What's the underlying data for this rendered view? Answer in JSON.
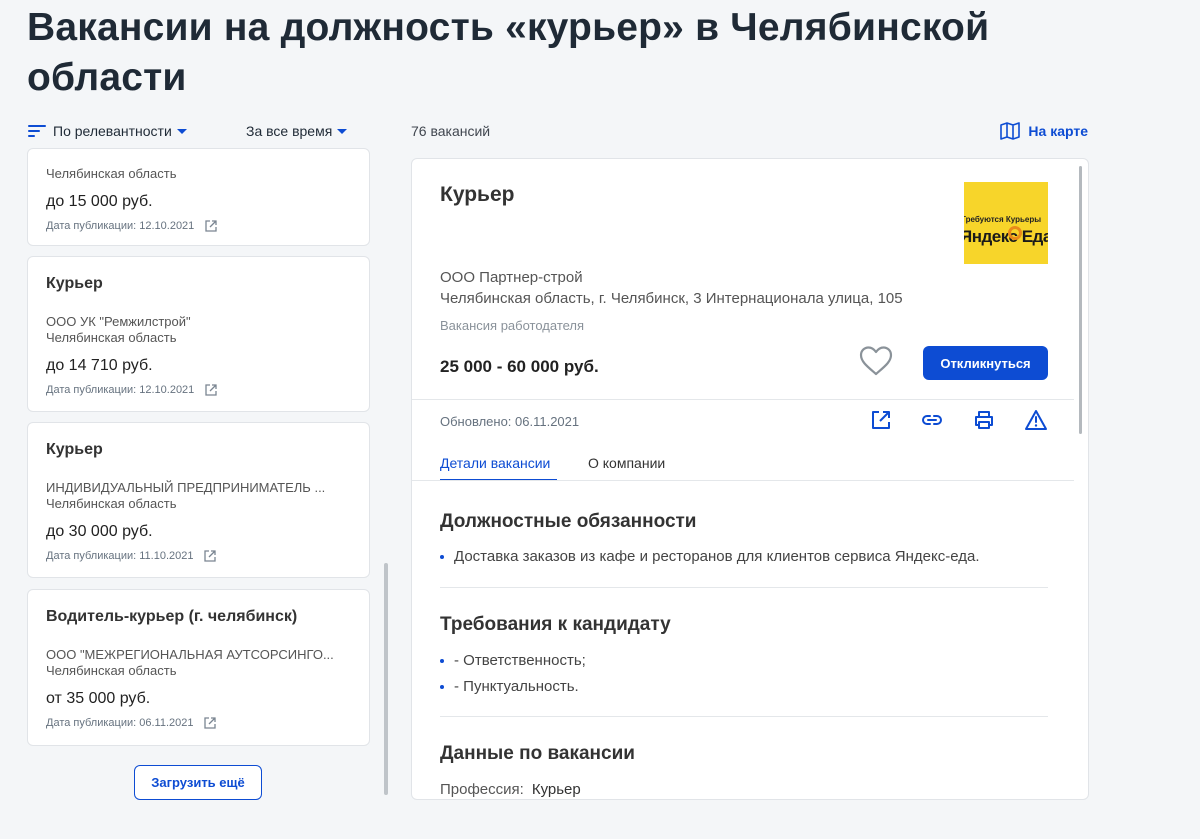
{
  "page": {
    "title": "Вакансии на должность «курьер» в Челябинской области"
  },
  "filters": {
    "sort_label": "По релевантности",
    "period_label": "За все время",
    "count_label": "76 вакансий",
    "map_label": "На карте"
  },
  "list": {
    "cards": [
      {
        "region": "Челябинская область",
        "salary": "до 15 000 руб.",
        "date": "Дата публикации: 12.10.2021"
      },
      {
        "title": "Курьер",
        "company": "ООО УК \"Ремжилстрой\"",
        "region": "Челябинская область",
        "salary": "до 14 710 руб.",
        "date": "Дата публикации: 12.10.2021"
      },
      {
        "title": "Курьер",
        "company": "ИНДИВИДУАЛЬНЫЙ ПРЕДПРИНИМАТЕЛЬ ...",
        "region": "Челябинская область",
        "salary": "до 30 000 руб.",
        "date": "Дата публикации: 11.10.2021"
      },
      {
        "title": "Водитель-курьер (г. челябинск)",
        "company": "ООО \"МЕЖРЕГИОНАЛЬНАЯ АУТСОРСИНГО...",
        "region": "Челябинская область",
        "salary": "от 35 000 руб.",
        "date": "Дата публикации: 06.11.2021"
      }
    ],
    "load_more_label": "Загрузить ещё"
  },
  "detail": {
    "title": "Курьер",
    "logo_text_top": "Требуются Курьеры",
    "logo_text_brand": "Яндекс Еда",
    "company": "ООО Партнер-строй",
    "address": "Челябинская область, г. Челябинск, 3 Интернационала улица, 105",
    "type": "Вакансия работодателя",
    "salary": "25 000 - 60 000 руб.",
    "apply_label": "Откликнуться",
    "updated": "Обновлено: 06.11.2021",
    "tabs": [
      "Детали вакансии",
      "О компании"
    ],
    "duties_title": "Должностные обязанности",
    "duties": [
      "Доставка заказов из кафе и ресторанов для клиентов сервиса Яндекс-еда."
    ],
    "requirements_title": "Требования к кандидату",
    "requirements": [
      "- Ответственность;",
      "- Пунктуальность."
    ],
    "data_title": "Данные по вакансии",
    "profession_label": "Профессия:",
    "profession_value": "Курьер"
  },
  "colors": {
    "accent": "#0d4cd3",
    "background": "#f4f6f8",
    "logo_yellow": "#f7d52a"
  }
}
